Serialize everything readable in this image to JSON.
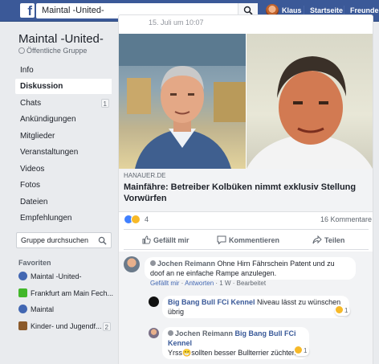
{
  "topbar": {
    "logo_letter": "f",
    "search_value": "Maintal -United-",
    "user_name": "Klaus",
    "home_label": "Startseite",
    "friends_label": "Freunde fin"
  },
  "group": {
    "title": "Maintal -United-",
    "privacy": "Öffentliche Gruppe"
  },
  "sidebar": {
    "items": [
      {
        "label": "Info"
      },
      {
        "label": "Diskussion"
      },
      {
        "label": "Chats",
        "badge": "1"
      },
      {
        "label": "Ankündigungen"
      },
      {
        "label": "Mitglieder"
      },
      {
        "label": "Veranstaltungen"
      },
      {
        "label": "Videos"
      },
      {
        "label": "Fotos"
      },
      {
        "label": "Dateien"
      },
      {
        "label": "Empfehlungen"
      }
    ],
    "search_placeholder": "Gruppe durchsuchen",
    "favorites_heading": "Favoriten",
    "favorites": [
      {
        "label": "Maintal -United-",
        "color": "#4267b2"
      },
      {
        "label": "Frankfurt am Main Fech...",
        "color": "#42b72a"
      },
      {
        "label": "Maintal",
        "color": "#4267b2"
      },
      {
        "label": "Kinder- und Jugendf...",
        "color": "#8b5a2b",
        "badge": "2"
      }
    ]
  },
  "post": {
    "date": "15. Juli um 10:07",
    "link_source": "HANAUER.DE",
    "link_title": "Mainfähre: Betreiber Kolbüken nimmt exklusiv Stellung Vorwürfen",
    "reaction_count": "4",
    "comment_count": "16 Kommentare",
    "actions": {
      "like": "Gefällt mir",
      "comment": "Kommentieren",
      "share": "Teilen"
    }
  },
  "comments": [
    {
      "author": "Jochen Reimann",
      "text": "Ohne Hirn Fährschein Patent und zu doof an ne einfache Rampe anzulegen.",
      "like": "Gefällt mir",
      "reply": "Antworten",
      "time": "1 W",
      "edited": "Bearbeitet"
    },
    {
      "author": "Big Bang Bull FCi Kennel",
      "text": "Niveau lässt zu wünschen übrig",
      "reaction_count": "1"
    },
    {
      "author": "Jochen Reimann",
      "mention": "Big Bang Bull FCi Kennel",
      "text": "Yrss😁sollten besser Bullterrier züchten",
      "reaction_count": "1"
    }
  ],
  "colors": {
    "brand": "#3b5998",
    "link": "#385898",
    "background": "#e9ebee"
  }
}
